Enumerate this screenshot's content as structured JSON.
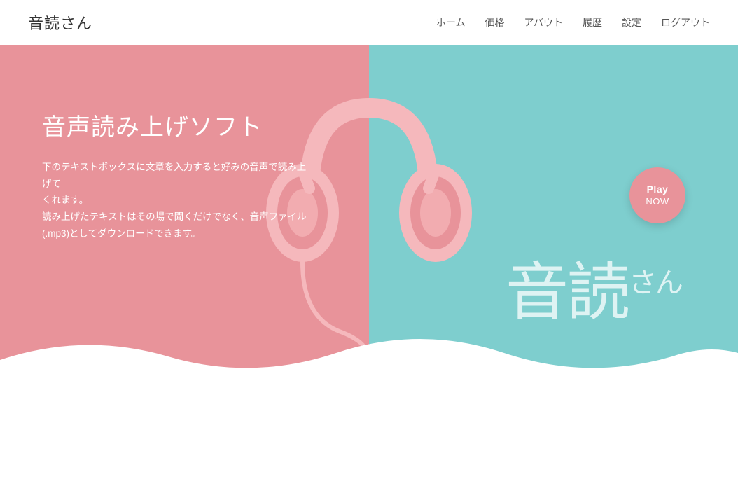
{
  "nav": {
    "logo": "音読さん",
    "links": [
      {
        "id": "home",
        "label": "ホーム"
      },
      {
        "id": "price",
        "label": "価格"
      },
      {
        "id": "about",
        "label": "アバウト"
      },
      {
        "id": "history",
        "label": "履歴"
      },
      {
        "id": "settings",
        "label": "設定"
      },
      {
        "id": "logout",
        "label": "ログアウト"
      }
    ]
  },
  "hero": {
    "title": "音声読み上げソフト",
    "description_line1": "下のテキストボックスに文章を入力すると好みの音声で読み上げて",
    "description_line2": "くれます。",
    "description_line3": "読み上げたテキストはその場で聞くだけでなく、音声ファイル",
    "description_line4": "(.mp3)としてダウンロードできます。",
    "brand_main": "音読",
    "brand_sub": "さん",
    "play_now_top": "Play",
    "play_now_bottom": "NOW",
    "colors": {
      "left_bg": "#e8939a",
      "right_bg": "#7ecece",
      "play_btn": "#e8939a"
    }
  }
}
